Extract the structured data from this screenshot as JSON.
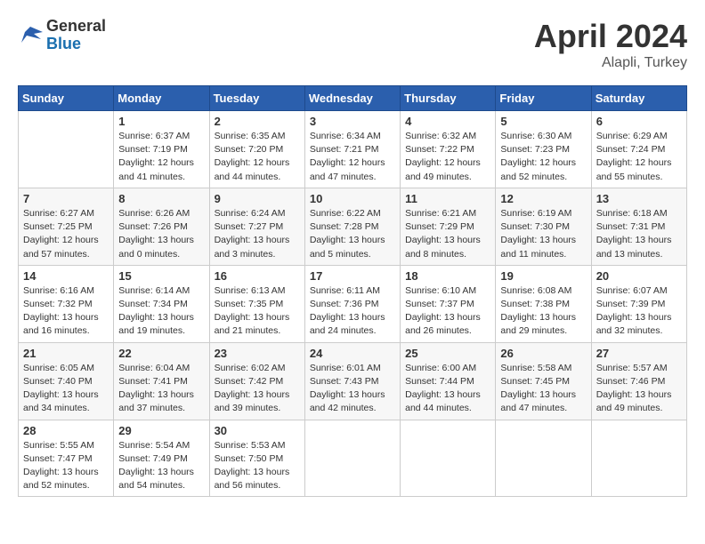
{
  "header": {
    "logo_general": "General",
    "logo_blue": "Blue",
    "month_title": "April 2024",
    "location": "Alapli, Turkey"
  },
  "weekdays": [
    "Sunday",
    "Monday",
    "Tuesday",
    "Wednesday",
    "Thursday",
    "Friday",
    "Saturday"
  ],
  "weeks": [
    [
      {
        "num": "",
        "info": ""
      },
      {
        "num": "1",
        "info": "Sunrise: 6:37 AM\nSunset: 7:19 PM\nDaylight: 12 hours\nand 41 minutes."
      },
      {
        "num": "2",
        "info": "Sunrise: 6:35 AM\nSunset: 7:20 PM\nDaylight: 12 hours\nand 44 minutes."
      },
      {
        "num": "3",
        "info": "Sunrise: 6:34 AM\nSunset: 7:21 PM\nDaylight: 12 hours\nand 47 minutes."
      },
      {
        "num": "4",
        "info": "Sunrise: 6:32 AM\nSunset: 7:22 PM\nDaylight: 12 hours\nand 49 minutes."
      },
      {
        "num": "5",
        "info": "Sunrise: 6:30 AM\nSunset: 7:23 PM\nDaylight: 12 hours\nand 52 minutes."
      },
      {
        "num": "6",
        "info": "Sunrise: 6:29 AM\nSunset: 7:24 PM\nDaylight: 12 hours\nand 55 minutes."
      }
    ],
    [
      {
        "num": "7",
        "info": "Sunrise: 6:27 AM\nSunset: 7:25 PM\nDaylight: 12 hours\nand 57 minutes."
      },
      {
        "num": "8",
        "info": "Sunrise: 6:26 AM\nSunset: 7:26 PM\nDaylight: 13 hours\nand 0 minutes."
      },
      {
        "num": "9",
        "info": "Sunrise: 6:24 AM\nSunset: 7:27 PM\nDaylight: 13 hours\nand 3 minutes."
      },
      {
        "num": "10",
        "info": "Sunrise: 6:22 AM\nSunset: 7:28 PM\nDaylight: 13 hours\nand 5 minutes."
      },
      {
        "num": "11",
        "info": "Sunrise: 6:21 AM\nSunset: 7:29 PM\nDaylight: 13 hours\nand 8 minutes."
      },
      {
        "num": "12",
        "info": "Sunrise: 6:19 AM\nSunset: 7:30 PM\nDaylight: 13 hours\nand 11 minutes."
      },
      {
        "num": "13",
        "info": "Sunrise: 6:18 AM\nSunset: 7:31 PM\nDaylight: 13 hours\nand 13 minutes."
      }
    ],
    [
      {
        "num": "14",
        "info": "Sunrise: 6:16 AM\nSunset: 7:32 PM\nDaylight: 13 hours\nand 16 minutes."
      },
      {
        "num": "15",
        "info": "Sunrise: 6:14 AM\nSunset: 7:34 PM\nDaylight: 13 hours\nand 19 minutes."
      },
      {
        "num": "16",
        "info": "Sunrise: 6:13 AM\nSunset: 7:35 PM\nDaylight: 13 hours\nand 21 minutes."
      },
      {
        "num": "17",
        "info": "Sunrise: 6:11 AM\nSunset: 7:36 PM\nDaylight: 13 hours\nand 24 minutes."
      },
      {
        "num": "18",
        "info": "Sunrise: 6:10 AM\nSunset: 7:37 PM\nDaylight: 13 hours\nand 26 minutes."
      },
      {
        "num": "19",
        "info": "Sunrise: 6:08 AM\nSunset: 7:38 PM\nDaylight: 13 hours\nand 29 minutes."
      },
      {
        "num": "20",
        "info": "Sunrise: 6:07 AM\nSunset: 7:39 PM\nDaylight: 13 hours\nand 32 minutes."
      }
    ],
    [
      {
        "num": "21",
        "info": "Sunrise: 6:05 AM\nSunset: 7:40 PM\nDaylight: 13 hours\nand 34 minutes."
      },
      {
        "num": "22",
        "info": "Sunrise: 6:04 AM\nSunset: 7:41 PM\nDaylight: 13 hours\nand 37 minutes."
      },
      {
        "num": "23",
        "info": "Sunrise: 6:02 AM\nSunset: 7:42 PM\nDaylight: 13 hours\nand 39 minutes."
      },
      {
        "num": "24",
        "info": "Sunrise: 6:01 AM\nSunset: 7:43 PM\nDaylight: 13 hours\nand 42 minutes."
      },
      {
        "num": "25",
        "info": "Sunrise: 6:00 AM\nSunset: 7:44 PM\nDaylight: 13 hours\nand 44 minutes."
      },
      {
        "num": "26",
        "info": "Sunrise: 5:58 AM\nSunset: 7:45 PM\nDaylight: 13 hours\nand 47 minutes."
      },
      {
        "num": "27",
        "info": "Sunrise: 5:57 AM\nSunset: 7:46 PM\nDaylight: 13 hours\nand 49 minutes."
      }
    ],
    [
      {
        "num": "28",
        "info": "Sunrise: 5:55 AM\nSunset: 7:47 PM\nDaylight: 13 hours\nand 52 minutes."
      },
      {
        "num": "29",
        "info": "Sunrise: 5:54 AM\nSunset: 7:49 PM\nDaylight: 13 hours\nand 54 minutes."
      },
      {
        "num": "30",
        "info": "Sunrise: 5:53 AM\nSunset: 7:50 PM\nDaylight: 13 hours\nand 56 minutes."
      },
      {
        "num": "",
        "info": ""
      },
      {
        "num": "",
        "info": ""
      },
      {
        "num": "",
        "info": ""
      },
      {
        "num": "",
        "info": ""
      }
    ]
  ]
}
